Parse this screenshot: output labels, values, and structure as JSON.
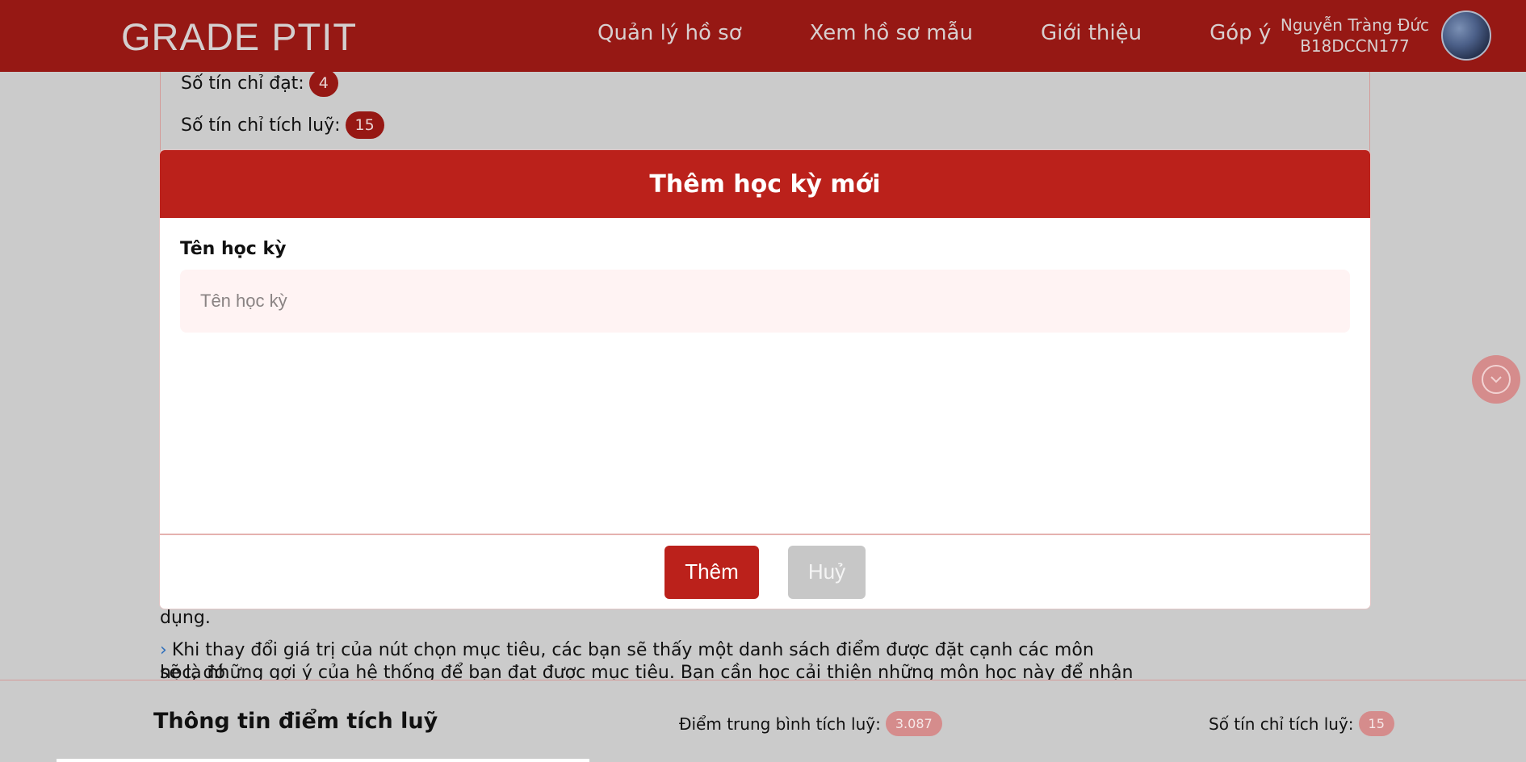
{
  "navbar": {
    "brand": "GRADE PTIT",
    "links": [
      "Quản lý hồ sơ",
      "Xem hồ sơ mẫu",
      "Giới thiệu",
      "Góp ý"
    ],
    "user": {
      "name": "Nguyễn Tràng Đức",
      "id": "B18DCCN177"
    }
  },
  "background": {
    "credits_passed_label": "Số tín chỉ đạt:",
    "credits_passed_value": "4",
    "credits_accumulated_label": "Số tín chỉ tích luỹ:",
    "credits_accumulated_value": "15",
    "text_line_1": "dụng.",
    "text_line_2": "Khi thay đổi giá trị của nút chọn mục tiêu, các bạn sẽ thấy một danh sách điểm được đặt cạnh các môn học, đó",
    "text_line_3": "sẽ là những gợi ý của hệ thống để bạn đạt được mục tiêu. Bạn cần học cải thiện những môn học này để nhận"
  },
  "modal": {
    "title": "Thêm học kỳ mới",
    "field_label": "Tên học kỳ",
    "field_placeholder": "Tên học kỳ",
    "field_value": "",
    "confirm_label": "Thêm",
    "cancel_label": "Huỷ"
  },
  "summary": {
    "title": "Thông tin điểm tích luỹ",
    "gpa_label": "Điểm trung bình tích luỹ:",
    "gpa_value": "3.087",
    "credits_label": "Số tín chỉ tích luỹ:",
    "credits_value": "15"
  },
  "icons": {
    "scroll_down": "chevron-down-icon",
    "list_bullet": "chevron-right-icon"
  },
  "colors": {
    "navbar": "#961814",
    "accent": "#bb211b",
    "input_bg": "#fff3f3",
    "soft_badge": "#d58c8c"
  }
}
